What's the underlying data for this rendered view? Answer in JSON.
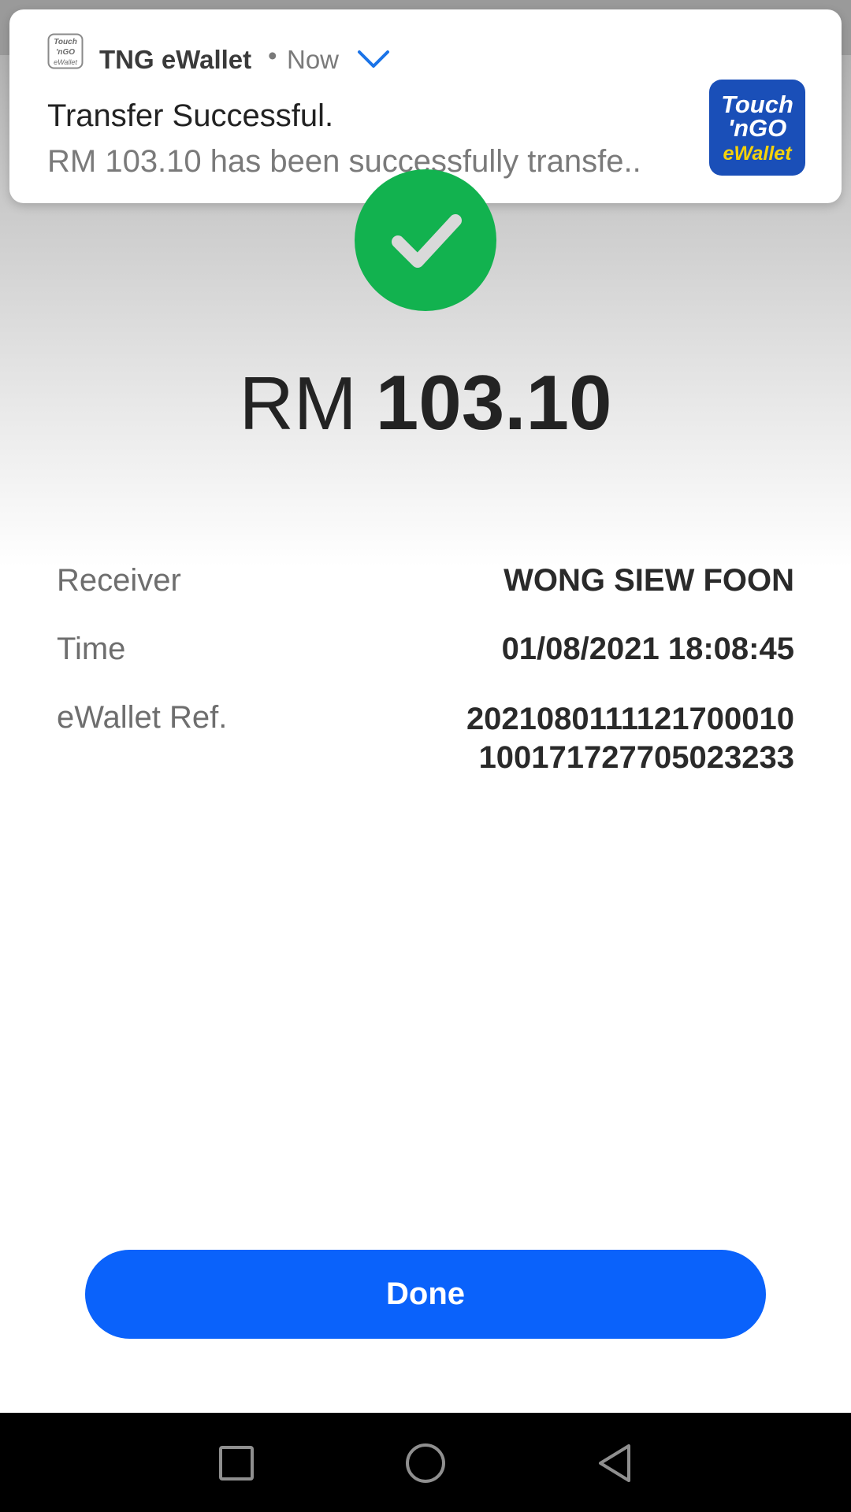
{
  "notification": {
    "app_name": "TNG eWallet",
    "separator": "•",
    "time": "Now",
    "title": "Transfer Successful.",
    "text": "RM 103.10 has been successfully transfe..",
    "small_icon_text": [
      "Touch",
      "'nGO",
      "eWallet"
    ],
    "logo_text": [
      "Touch",
      "'nGO",
      "eWallet"
    ],
    "chevron_icon": "chevron-down-icon",
    "accent_color": "#1a73e8"
  },
  "status": {
    "icon": "check-icon",
    "color": "#12b24f"
  },
  "amount": {
    "currency": "RM",
    "value": "103.10"
  },
  "details": {
    "receiver_label": "Receiver",
    "receiver_value": "WONG SIEW FOON",
    "time_label": "Time",
    "time_value": "01/08/2021 18:08:45",
    "ref_label": "eWallet Ref.",
    "ref_line1": "2021080111121700010",
    "ref_line2": "100171727705023233"
  },
  "done_button": {
    "label": "Done",
    "color": "#0a62fb"
  },
  "navbar": {
    "recents_icon": "square-icon",
    "home_icon": "circle-icon",
    "back_icon": "triangle-back-icon"
  }
}
